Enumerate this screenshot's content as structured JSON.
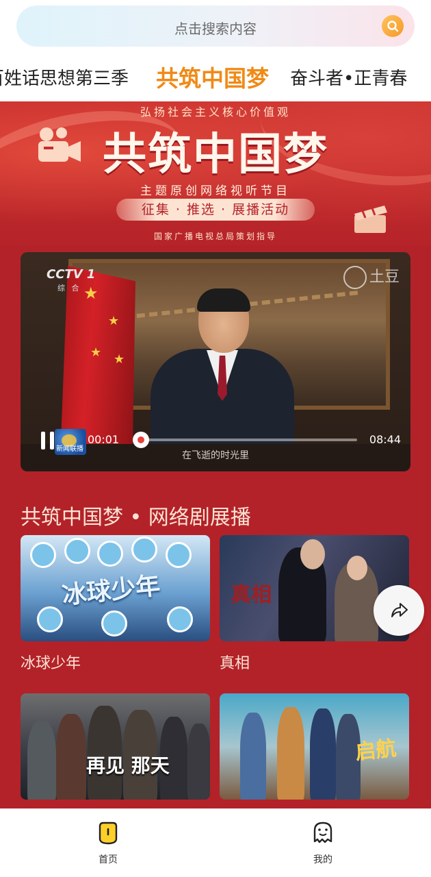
{
  "search": {
    "placeholder": "点击搜索内容"
  },
  "tabs": [
    {
      "label": "百姓话思想第三季"
    },
    {
      "label": "共筑中国梦"
    },
    {
      "label": "奋斗者•正青春"
    }
  ],
  "banner": {
    "top_line": "弘扬社会主义核心价值观",
    "title": "共筑中国梦",
    "subtitle": "主题原创网络视听节目",
    "pill": "征集 · 推选 · 展播活动",
    "bottom_line": "国家广播电视总局策划指导"
  },
  "video": {
    "channel_logo": "CCTV 1",
    "channel_sub": "综 合",
    "watermark": "土豆",
    "news_logo_text": "新闻联播",
    "current_time": "00:01",
    "total_time": "08:44",
    "progress": 0.002,
    "subtitle": "在飞逝的时光里"
  },
  "section": {
    "title": "共筑中国梦 • 网络剧展播",
    "items": [
      {
        "label": "冰球少年",
        "poster_text": "冰球少年"
      },
      {
        "label": "真相",
        "poster_text": "真相"
      },
      {
        "label": "",
        "poster_text": "再见 那天"
      },
      {
        "label": "",
        "poster_text": "启航"
      }
    ]
  },
  "nav": {
    "home_label": "首页",
    "mine_label": "我的"
  },
  "colors": {
    "accent": "#f08a16",
    "background_red": "#b32229"
  }
}
